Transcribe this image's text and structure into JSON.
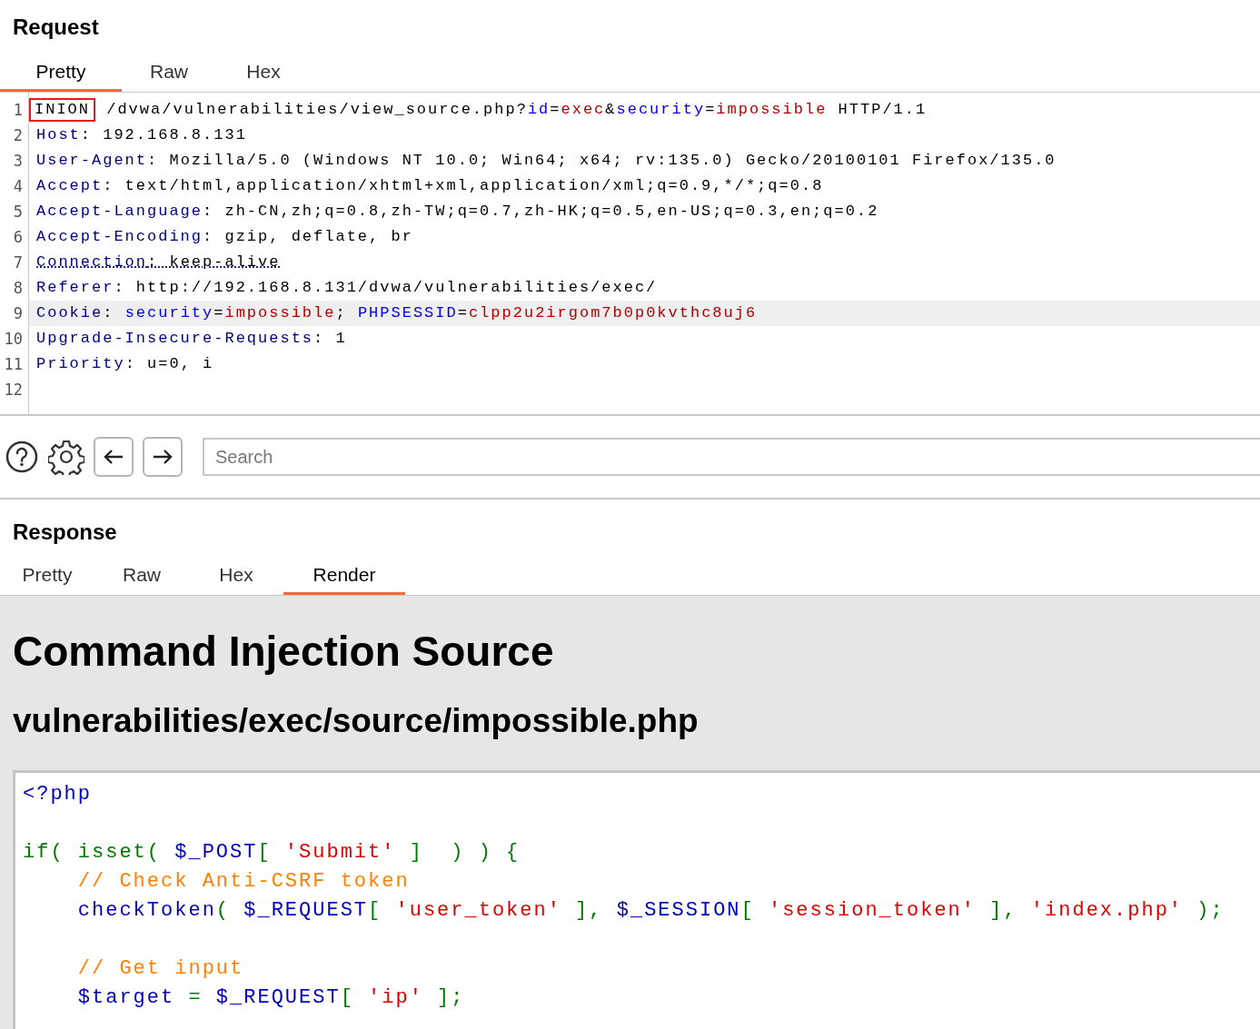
{
  "request": {
    "title": "Request",
    "tabs": [
      {
        "label": "Pretty",
        "selected": true
      },
      {
        "label": "Raw",
        "selected": false
      },
      {
        "label": "Hex",
        "selected": false
      }
    ],
    "lines": [
      {
        "number": "1",
        "selected": false,
        "underlined": false,
        "tokens": [
          {
            "text": "INION",
            "kind": "boxed"
          },
          {
            "text": " /dvwa/vulnerabilities/view_source.php?",
            "kind": "plain"
          },
          {
            "text": "id",
            "kind": "param"
          },
          {
            "text": "=",
            "kind": "plain"
          },
          {
            "text": "exec",
            "kind": "value"
          },
          {
            "text": "&",
            "kind": "plain"
          },
          {
            "text": "security",
            "kind": "param"
          },
          {
            "text": "=",
            "kind": "plain"
          },
          {
            "text": "impossible",
            "kind": "value"
          },
          {
            "text": " HTTP/1.1",
            "kind": "plain"
          }
        ]
      },
      {
        "number": "2",
        "selected": false,
        "underlined": false,
        "tokens": [
          {
            "text": "Host",
            "kind": "name"
          },
          {
            "text": ": 192.168.8.131",
            "kind": "plain"
          }
        ]
      },
      {
        "number": "3",
        "selected": false,
        "underlined": false,
        "tokens": [
          {
            "text": "User-Agent",
            "kind": "name"
          },
          {
            "text": ": Mozilla/5.0 (Windows NT 10.0; Win64; x64; rv:135.0) Gecko/20100101 Firefox/135.0",
            "kind": "plain"
          }
        ]
      },
      {
        "number": "4",
        "selected": false,
        "underlined": false,
        "tokens": [
          {
            "text": "Accept",
            "kind": "name"
          },
          {
            "text": ": text/html,application/xhtml+xml,application/xml;q=0.9,*/*;q=0.8",
            "kind": "plain"
          }
        ]
      },
      {
        "number": "5",
        "selected": false,
        "underlined": false,
        "tokens": [
          {
            "text": "Accept-Language",
            "kind": "name"
          },
          {
            "text": ": zh-CN,zh;q=0.8,zh-TW;q=0.7,zh-HK;q=0.5,en-US;q=0.3,en;q=0.2",
            "kind": "plain"
          }
        ]
      },
      {
        "number": "6",
        "selected": false,
        "underlined": false,
        "tokens": [
          {
            "text": "Accept-Encoding",
            "kind": "name"
          },
          {
            "text": ": gzip, deflate, br",
            "kind": "plain"
          }
        ]
      },
      {
        "number": "7",
        "selected": false,
        "underlined": true,
        "tokens": [
          {
            "text": "Connection",
            "kind": "name"
          },
          {
            "text": ": keep-alive",
            "kind": "plain"
          }
        ]
      },
      {
        "number": "8",
        "selected": false,
        "underlined": false,
        "tokens": [
          {
            "text": "Referer",
            "kind": "name"
          },
          {
            "text": ": http://192.168.8.131/dvwa/vulnerabilities/exec/",
            "kind": "plain"
          }
        ]
      },
      {
        "number": "9",
        "selected": true,
        "underlined": false,
        "tokens": [
          {
            "text": "Cookie",
            "kind": "name"
          },
          {
            "text": ": ",
            "kind": "plain"
          },
          {
            "text": "security",
            "kind": "param"
          },
          {
            "text": "=",
            "kind": "plain"
          },
          {
            "text": "impossible",
            "kind": "value"
          },
          {
            "text": "; ",
            "kind": "plain"
          },
          {
            "text": "PHPSESSID",
            "kind": "param"
          },
          {
            "text": "=",
            "kind": "plain"
          },
          {
            "text": "clpp2u2irgom7b0p0kvthc8uj6",
            "kind": "value"
          }
        ]
      },
      {
        "number": "10",
        "selected": false,
        "underlined": false,
        "tokens": [
          {
            "text": "Upgrade-Insecure-Requests",
            "kind": "name"
          },
          {
            "text": ": 1",
            "kind": "plain"
          }
        ]
      },
      {
        "number": "11",
        "selected": false,
        "underlined": false,
        "tokens": [
          {
            "text": "Priority",
            "kind": "name"
          },
          {
            "text": ": u=0, i",
            "kind": "plain"
          }
        ]
      },
      {
        "number": "12"
      }
    ]
  },
  "toolbar": {
    "search": {
      "placeholder": "Search"
    }
  },
  "response": {
    "title": "Response",
    "tabs": [
      {
        "label": "Pretty",
        "selected": false
      },
      {
        "label": "Raw",
        "selected": false
      },
      {
        "label": "Hex",
        "selected": false
      },
      {
        "label": "Render",
        "selected": true
      }
    ],
    "render": {
      "heading": "Command Injection Source",
      "subheading": "vulnerabilities/exec/source/impossible.php",
      "code_lines": [
        {
          "kind": "code",
          "tokens": [
            {
              "text": "<?php",
              "kind": "default"
            }
          ]
        },
        {
          "kind": "blank"
        },
        {
          "kind": "code",
          "tokens": [
            {
              "text": "if( ",
              "kind": "keyword"
            },
            {
              "text": "isset( ",
              "kind": "keyword"
            },
            {
              "text": "$_POST",
              "kind": "default"
            },
            {
              "text": "[ ",
              "kind": "keyword"
            },
            {
              "text": "'Submit'",
              "kind": "string"
            },
            {
              "text": " ]  ) ) {",
              "kind": "keyword"
            }
          ]
        },
        {
          "kind": "code",
          "tokens": [
            {
              "text": "    // Check Anti-CSRF token",
              "kind": "comment"
            }
          ]
        },
        {
          "kind": "code",
          "tokens": [
            {
              "text": "    checkToken",
              "kind": "default"
            },
            {
              "text": "( ",
              "kind": "keyword"
            },
            {
              "text": "$_REQUEST",
              "kind": "default"
            },
            {
              "text": "[ ",
              "kind": "keyword"
            },
            {
              "text": "'user_token'",
              "kind": "string"
            },
            {
              "text": " ], ",
              "kind": "keyword"
            },
            {
              "text": "$_SESSION",
              "kind": "default"
            },
            {
              "text": "[ ",
              "kind": "keyword"
            },
            {
              "text": "'session_token'",
              "kind": "string"
            },
            {
              "text": " ], ",
              "kind": "keyword"
            },
            {
              "text": "'index.php'",
              "kind": "string"
            },
            {
              "text": " );",
              "kind": "keyword"
            }
          ]
        },
        {
          "kind": "blank"
        },
        {
          "kind": "code",
          "tokens": [
            {
              "text": "    // Get input",
              "kind": "comment"
            }
          ]
        },
        {
          "kind": "code",
          "tokens": [
            {
              "text": "    $target ",
              "kind": "default"
            },
            {
              "text": "= ",
              "kind": "keyword"
            },
            {
              "text": "$_REQUEST",
              "kind": "default"
            },
            {
              "text": "[ ",
              "kind": "keyword"
            },
            {
              "text": "'ip'",
              "kind": "string"
            },
            {
              "text": " ];",
              "kind": "keyword"
            }
          ]
        }
      ]
    }
  }
}
